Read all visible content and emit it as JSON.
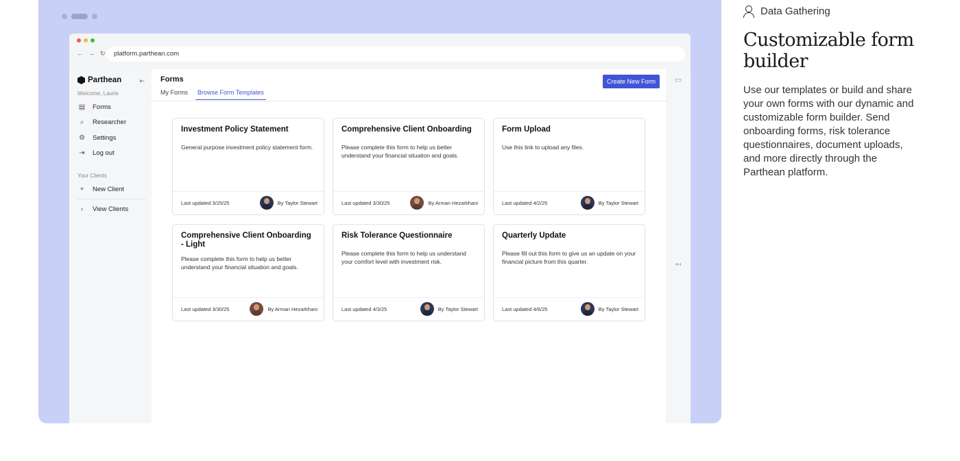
{
  "browser": {
    "url": "platform.parthean.com",
    "traffic_colors": [
      "#ee5b52",
      "#f4b840",
      "#3fb94c"
    ]
  },
  "sidebar": {
    "brand": "Parthean",
    "welcome": "Welcome, Laurie",
    "items": [
      {
        "label": "Forms",
        "icon": "document-icon"
      },
      {
        "label": "Researcher",
        "icon": "search-icon"
      },
      {
        "label": "Settings",
        "icon": "gear-icon"
      },
      {
        "label": "Log out",
        "icon": "logout-icon"
      }
    ],
    "clients_section": "Your Clients",
    "client_items": [
      {
        "label": "New Client",
        "icon": "plus-icon"
      },
      {
        "label": "View Clients",
        "icon": "chevron-right-icon"
      }
    ]
  },
  "main": {
    "title": "Forms",
    "tabs": [
      {
        "label": "My Forms",
        "active": false
      },
      {
        "label": "Browse Form Templates",
        "active": true
      }
    ],
    "create_button": "Create New Form",
    "accent_color": "#4254d6"
  },
  "cards": [
    {
      "title": "Investment Policy Statement",
      "description": "General purpose investment policy statement form.",
      "updated": "Last updated 3/25/25",
      "author": "By Taylor Stewart"
    },
    {
      "title": "Comprehensive Client Onboarding",
      "description": "Please complete this form to help us better understand your financial situation and goals.",
      "updated": "Last updated 3/30/25",
      "author": "By Arman Hezarkhani"
    },
    {
      "title": "Form Upload",
      "description": "Use this link to upload any files.",
      "updated": "Last updated 4/2/25",
      "author": "By Taylor Stewart"
    },
    {
      "title": "Comprehensive Client Onboarding - Light",
      "description": "Please complete this form to help us better understand your financial situation and goals.",
      "updated": "Last updated 3/30/25",
      "author": "By Arman Hezarkhani"
    },
    {
      "title": "Risk Tolerance Questionnaire",
      "description": "Please complete this form to help us understand your comfort level with investment risk.",
      "updated": "Last updated 4/3/25",
      "author": "By Taylor Stewart"
    },
    {
      "title": "Quarterly Update",
      "description": "Please fill out this form to give us an update on your financial picture from this quarter.",
      "updated": "Last updated 4/6/25",
      "author": "By Taylor Stewart"
    }
  ],
  "feature": {
    "tag": "Data Gathering",
    "headline": "Customizable form builder",
    "body": "Use our templates or build and share your own forms with our dynamic and customizable form builder. Send onboarding forms, risk tolerance questionnaires, document uploads, and more directly through the Parthean platform."
  },
  "panel_color": "#c9d0f7"
}
